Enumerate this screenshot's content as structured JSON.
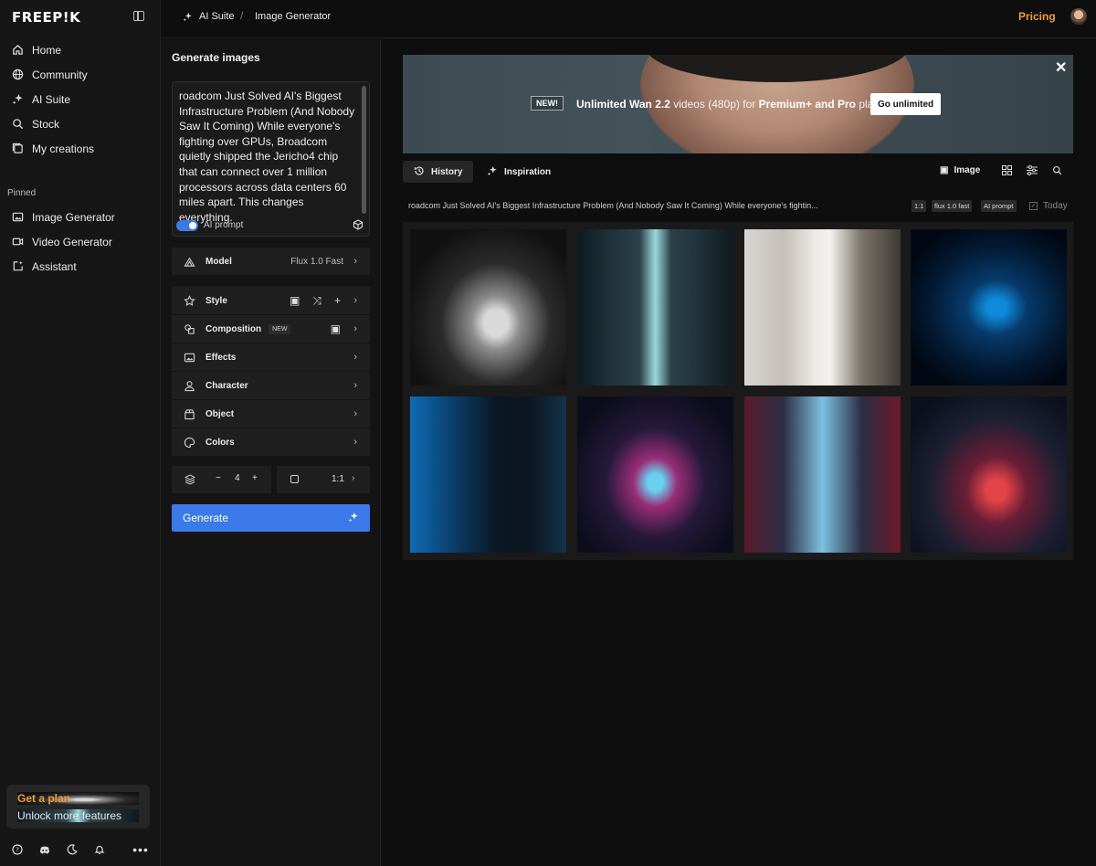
{
  "brand": {
    "logo": "FREEP!K"
  },
  "sidebar": {
    "nav": [
      {
        "label": "Home",
        "icon": "home-icon"
      },
      {
        "label": "Community",
        "icon": "globe-icon"
      },
      {
        "label": "AI Suite",
        "icon": "sparkles-icon"
      },
      {
        "label": "Stock",
        "icon": "search-icon"
      },
      {
        "label": "My creations",
        "icon": "gallery-icon"
      }
    ],
    "pinned_label": "Pinned",
    "pinned": [
      {
        "label": "Image Generator",
        "icon": "image-icon"
      },
      {
        "label": "Video Generator",
        "icon": "video-icon"
      },
      {
        "label": "Assistant",
        "icon": "assistant-icon"
      }
    ],
    "plan": {
      "title": "Get a plan",
      "subtitle": "Unlock more features"
    }
  },
  "topbar": {
    "breadcrumb": [
      "AI Suite",
      "Image Generator"
    ],
    "separator": "/",
    "pricing": "Pricing"
  },
  "panel": {
    "title": "Generate images",
    "prompt": "roadcom Just Solved AI's Biggest Infrastructure Problem (And Nobody Saw It Coming) While everyone's fighting over GPUs, Broadcom quietly shipped the Jericho4 chip that can connect over 1 million processors across data centers 60 miles apart. This changes everything.",
    "ai_prompt_label": "AI prompt",
    "model_label": "Model",
    "model_value": "Flux 1.0 Fast",
    "options": [
      "Style",
      "Composition",
      "Effects",
      "Character",
      "Object",
      "Colors"
    ],
    "new_badge": "NEW",
    "count": "4",
    "minus": "−",
    "plus": "+",
    "ratio": "1:1",
    "generate": "Generate"
  },
  "banner": {
    "new_tag": "NEW!",
    "text_bold1": "Unlimited Wan 2.2",
    "text_mid": " videos (480p) for ",
    "text_bold2": "Premium+ and Pro",
    "text_end": " plans",
    "button": "Go unlimited"
  },
  "main": {
    "tabs": [
      "History",
      "Inspiration"
    ],
    "image_tool": "Image",
    "prompt_line": "roadcom Just Solved AI's Biggest Infrastructure Problem (And Nobody Saw It Coming) While everyone's fightin...",
    "pills": [
      "1:1",
      "flux 1.0 fast",
      "AI prompt"
    ],
    "today": "Today"
  }
}
